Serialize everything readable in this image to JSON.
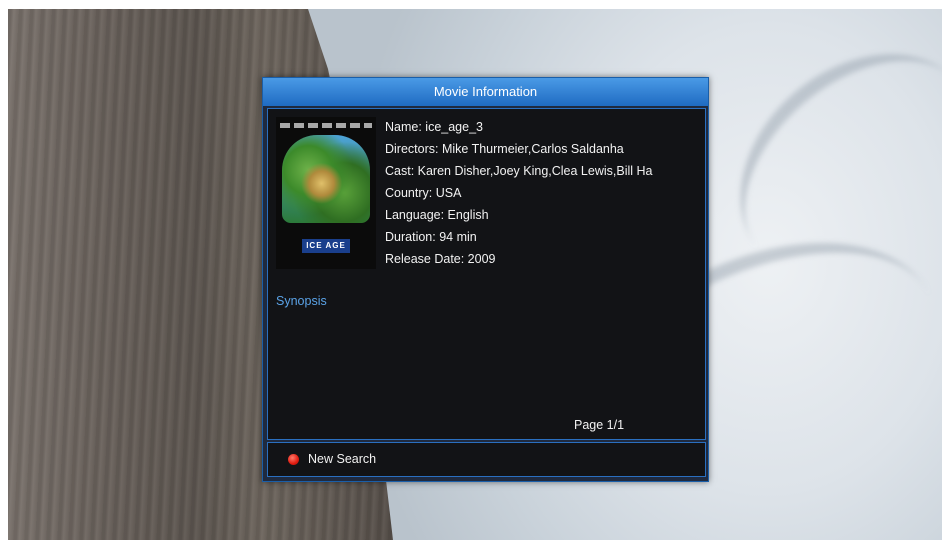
{
  "dialog": {
    "title": "Movie Information",
    "movie": {
      "name_line": "Name: ice_age_3",
      "directors_line": "Directors: Mike Thurmeier,Carlos Saldanha",
      "cast_line": "Cast: Karen Disher,Joey King,Clea Lewis,Bill Ha",
      "country_line": "Country: USA",
      "language_line": "Language: English",
      "duration_line": "Duration: 94 min",
      "release_line": "Release Date: 2009"
    },
    "synopsis_label": "Synopsis",
    "page_indicator": "Page 1/1",
    "footer": {
      "new_search_label": "New Search",
      "new_search_color": "#e01b10"
    }
  },
  "poster": {
    "icon": "movie-poster-image",
    "logo_text": "ICE AGE"
  },
  "colors": {
    "title_bar": "#1f6bc2",
    "panel_border": "#2a6fc0",
    "panel_bg": "#121316",
    "synopsis_text": "#5aa2e6"
  }
}
